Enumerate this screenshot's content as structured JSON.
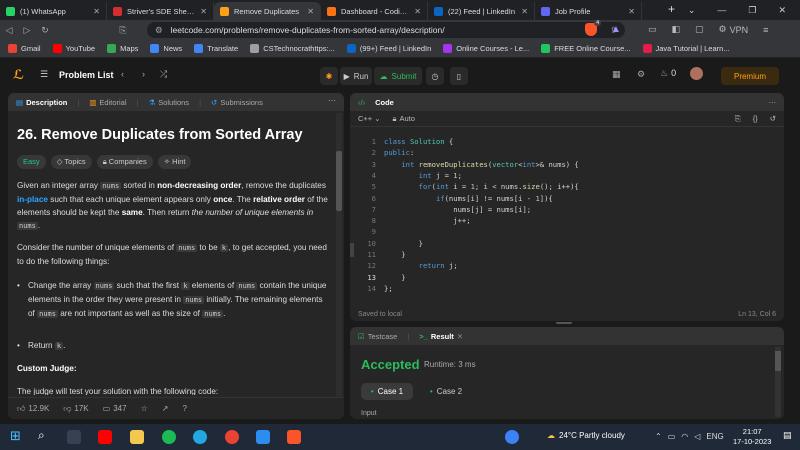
{
  "browser": {
    "tabs": [
      {
        "label": "(1) WhatsApp",
        "color": "#25d366",
        "active": false
      },
      {
        "label": "Striver's SDE Sheet – Top",
        "color": "#d32f2f",
        "active": false
      },
      {
        "label": "Remove Duplicates",
        "color": "#ffa116",
        "active": true
      },
      {
        "label": "Dashboard - Coding Nin",
        "color": "#f97316",
        "active": false
      },
      {
        "label": "(22) Feed | LinkedIn",
        "color": "#0a66c2",
        "active": false
      },
      {
        "label": "Job Profile",
        "color": "#6366f1",
        "active": false
      }
    ],
    "url": "leetcode.com/problems/remove-duplicates-from-sorted-array/description/",
    "vpn_label": "VPN",
    "bookmarks": [
      {
        "label": "Gmail",
        "color": "#ea4335"
      },
      {
        "label": "YouTube",
        "color": "#ff0000"
      },
      {
        "label": "Maps",
        "color": "#34a853"
      },
      {
        "label": "News",
        "color": "#4285f4"
      },
      {
        "label": "Translate",
        "color": "#4285f4"
      },
      {
        "label": "CSTechnocrathttps:...",
        "color": "#9e9e9e"
      },
      {
        "label": "(99+) Feed | LinkedIn",
        "color": "#0a66c2"
      },
      {
        "label": "Online Courses - Le...",
        "color": "#a435f0"
      },
      {
        "label": "FREE Online Course...",
        "color": "#22c55e"
      },
      {
        "label": "Java Tutorial | Learn...",
        "color": "#e11d48"
      }
    ],
    "badge_count": "4"
  },
  "leetcode": {
    "problem_list": "Problem List",
    "run": "Run",
    "submit": "Submit",
    "streak": "0",
    "premium": "Premium"
  },
  "description": {
    "tabs": [
      "Description",
      "Editorial",
      "Solutions",
      "Submissions"
    ],
    "title": "26. Remove Duplicates from Sorted Array",
    "chips": [
      "Easy",
      "Topics",
      "Companies",
      "Hint"
    ],
    "p1": {
      "a": "Given an integer array ",
      "code1": "nums",
      "b": " sorted in ",
      "bold1": "non-decreasing order",
      "c": ", remove the duplicates ",
      "blue1": "in-place",
      "d": " such that each unique element appears only ",
      "bold2": "once",
      "e": ". The ",
      "bold3": "relative order",
      "f": " of the elements should be kept the ",
      "bold4": "same",
      "g": ". Then return ",
      "italic1": "the number of unique elements in",
      "code2": "nums",
      "h": "."
    },
    "p2": {
      "a": "Consider the number of unique elements of ",
      "code1": "nums",
      "b": " to be ",
      "code2": "k",
      "c": ", to get accepted, you need to do the following things:"
    },
    "bullet1": {
      "a": "Change the array ",
      "code1": "nums",
      "b": " such that the first ",
      "code2": "k",
      "c": " elements of ",
      "code3": "nums",
      "d": " contain the unique elements in the order they were present in ",
      "code4": "nums",
      "e": " initially. The remaining elements of ",
      "code5": "nums",
      "f": " are not important as well as the size of ",
      "code6": "nums",
      "g": "."
    },
    "bullet2": {
      "a": "Return ",
      "code1": "k",
      "b": "."
    },
    "custom_judge": "Custom Judge:",
    "judge_text": "The judge will test your solution with the following code:",
    "footer": {
      "likes": "12.9K",
      "dislikes": "17K",
      "comments": "347"
    }
  },
  "code": {
    "header": "Code",
    "lang": "C++",
    "auto": "Auto",
    "lines": [
      "class Solution {",
      "public:",
      "    int removeDuplicates(vector<int>& nums) {",
      "        int j = 1;",
      "        for(int i = 1; i < nums.size(); i++){",
      "            if(nums[i] != nums[i - 1]){",
      "                nums[j] = nums[i];",
      "                j++;",
      "",
      "        }",
      "    }",
      "        return j;",
      "    }",
      "};"
    ],
    "saved": "Saved to local",
    "cursor": "Ln 13, Col 6"
  },
  "result": {
    "tab_testcase": "Testcase",
    "tab_result": "Result",
    "status": "Accepted",
    "runtime": "Runtime: 3 ms",
    "cases": [
      "Case 1",
      "Case 2"
    ],
    "input_label": "Input"
  },
  "taskbar": {
    "weather": "24°C  Partly cloudy",
    "lang": "ENG",
    "time": "21:07",
    "date": "17-10-2023"
  }
}
